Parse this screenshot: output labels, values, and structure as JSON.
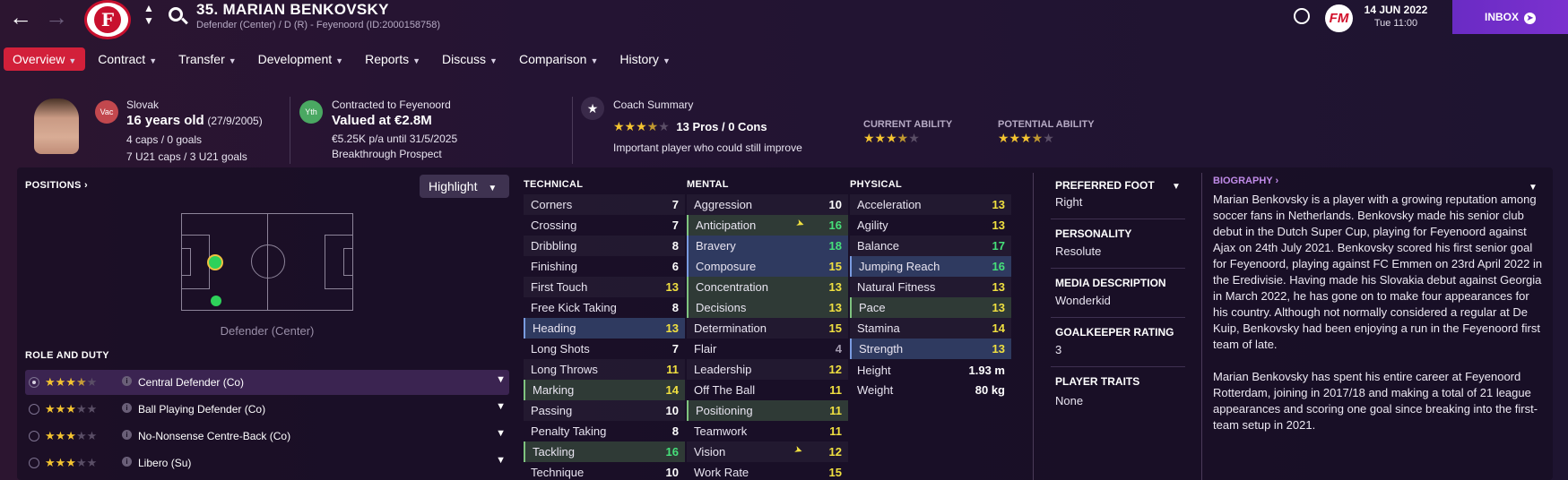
{
  "header": {
    "player_name": "35. MARIAN BENKOVSKY",
    "player_sub": "Defender (Center) / D (R) - Feyenoord (ID:2000158758)",
    "date": "14 JUN 2022",
    "time": "Tue 11:00",
    "inbox_label": "INBOX",
    "fm_logo": "FM",
    "club_crest_letter": "F"
  },
  "tabs": [
    {
      "label": "Overview",
      "active": true
    },
    {
      "label": "Contract"
    },
    {
      "label": "Transfer"
    },
    {
      "label": "Development"
    },
    {
      "label": "Reports"
    },
    {
      "label": "Discuss"
    },
    {
      "label": "Comparison"
    },
    {
      "label": "History"
    }
  ],
  "profile": {
    "nationality": "Slovak",
    "age": "16 years old",
    "dob": "(27/9/2005)",
    "caps": "4 caps / 0 goals",
    "u21": "7 U21 caps / 3 U21 goals",
    "badge_vac": "Vac",
    "badge_yth": "Yth",
    "contract_to": "Contracted to Feyenoord",
    "valued": "Valued at €2.8M",
    "wage": "€5.25K p/a until 31/5/2025",
    "prospect": "Breakthrough Prospect",
    "coach_summary_title": "Coach Summary",
    "pros_cons": "13 Pros / 0 Cons",
    "coach_comment": "Important player who could still improve",
    "current_ability_label": "CURRENT ABILITY",
    "potential_ability_label": "POTENTIAL ABILITY",
    "coach_stars": 3.5,
    "current_ability_stars": 3.5,
    "potential_ability_stars": 3.5
  },
  "positions": {
    "title": "POSITIONS",
    "highlight_label": "Highlight",
    "caption": "Defender (Center)"
  },
  "roles": {
    "title": "ROLE AND DUTY",
    "items": [
      {
        "name": "Central Defender (Co)",
        "stars": 3.5,
        "selected": true
      },
      {
        "name": "Ball Playing Defender (Co)",
        "stars": 3
      },
      {
        "name": "No-Nonsense Centre-Back (Co)",
        "stars": 3
      },
      {
        "name": "Libero (Su)",
        "stars": 3
      }
    ]
  },
  "attributes": {
    "technical_title": "TECHNICAL",
    "mental_title": "MENTAL",
    "physical_title": "PHYSICAL",
    "technical": [
      {
        "name": "Corners",
        "value": "7"
      },
      {
        "name": "Crossing",
        "value": "7"
      },
      {
        "name": "Dribbling",
        "value": "8"
      },
      {
        "name": "Finishing",
        "value": "6"
      },
      {
        "name": "First Touch",
        "value": "13"
      },
      {
        "name": "Free Kick Taking",
        "value": "8"
      },
      {
        "name": "Heading",
        "value": "13",
        "hl": "blue"
      },
      {
        "name": "Long Shots",
        "value": "7"
      },
      {
        "name": "Long Throws",
        "value": "11"
      },
      {
        "name": "Marking",
        "value": "14",
        "hl": "green"
      },
      {
        "name": "Passing",
        "value": "10"
      },
      {
        "name": "Penalty Taking",
        "value": "8"
      },
      {
        "name": "Tackling",
        "value": "16",
        "hl": "green"
      },
      {
        "name": "Technique",
        "value": "10"
      }
    ],
    "mental": [
      {
        "name": "Aggression",
        "value": "10"
      },
      {
        "name": "Anticipation",
        "value": "16",
        "hl": "green",
        "arrow": true
      },
      {
        "name": "Bravery",
        "value": "18",
        "hl": "blue"
      },
      {
        "name": "Composure",
        "value": "15",
        "hl": "blue"
      },
      {
        "name": "Concentration",
        "value": "13",
        "hl": "green"
      },
      {
        "name": "Decisions",
        "value": "13",
        "hl": "green"
      },
      {
        "name": "Determination",
        "value": "15"
      },
      {
        "name": "Flair",
        "value": "4"
      },
      {
        "name": "Leadership",
        "value": "12"
      },
      {
        "name": "Off The Ball",
        "value": "11"
      },
      {
        "name": "Positioning",
        "value": "11",
        "hl": "green"
      },
      {
        "name": "Teamwork",
        "value": "11"
      },
      {
        "name": "Vision",
        "value": "12",
        "arrow": true
      },
      {
        "name": "Work Rate",
        "value": "15"
      }
    ],
    "physical": [
      {
        "name": "Acceleration",
        "value": "13"
      },
      {
        "name": "Agility",
        "value": "13"
      },
      {
        "name": "Balance",
        "value": "17"
      },
      {
        "name": "Jumping Reach",
        "value": "16",
        "hl": "blue"
      },
      {
        "name": "Natural Fitness",
        "value": "13"
      },
      {
        "name": "Pace",
        "value": "13",
        "hl": "green"
      },
      {
        "name": "Stamina",
        "value": "14"
      },
      {
        "name": "Strength",
        "value": "13",
        "hl": "blue"
      }
    ],
    "height_label": "Height",
    "height": "1.93 m",
    "weight_label": "Weight",
    "weight": "80 kg"
  },
  "details": {
    "preferred_foot_label": "PREFERRED FOOT",
    "preferred_foot": "Right",
    "personality_label": "PERSONALITY",
    "personality": "Resolute",
    "media_label": "MEDIA DESCRIPTION",
    "media": "Wonderkid",
    "gk_label": "GOALKEEPER RATING",
    "gk": "3",
    "traits_label": "PLAYER TRAITS",
    "traits": "None"
  },
  "biography": {
    "title": "BIOGRAPHY",
    "p1": "Marian Benkovsky is a player with a growing reputation among soccer fans in Netherlands. Benkovsky made his senior club debut in the Dutch Super Cup, playing for Feyenoord against Ajax on 24th July 2021. Benkovsky scored his first senior goal for Feyenoord, playing against FC Emmen on 23rd April 2022 in the Eredivisie. Having made his Slovakia debut against Georgia in March 2022, he has gone on to make four appearances for his country. Although not normally considered a regular at De Kuip, Benkovsky had been enjoying a run in the Feyenoord first team of late.",
    "p2": "Marian Benkovsky has spent his entire career at Feyenoord Rotterdam, joining in 2017/18 and making a total of 21 league appearances and scoring one goal since breaking into the first-team setup in 2021."
  },
  "colors": {
    "accent_red": "#d2203a",
    "inbox_purple": "#6a2bc4",
    "star_gold": "#f4c430",
    "value_green": "#46e07a",
    "value_yellow": "#f0e040"
  }
}
